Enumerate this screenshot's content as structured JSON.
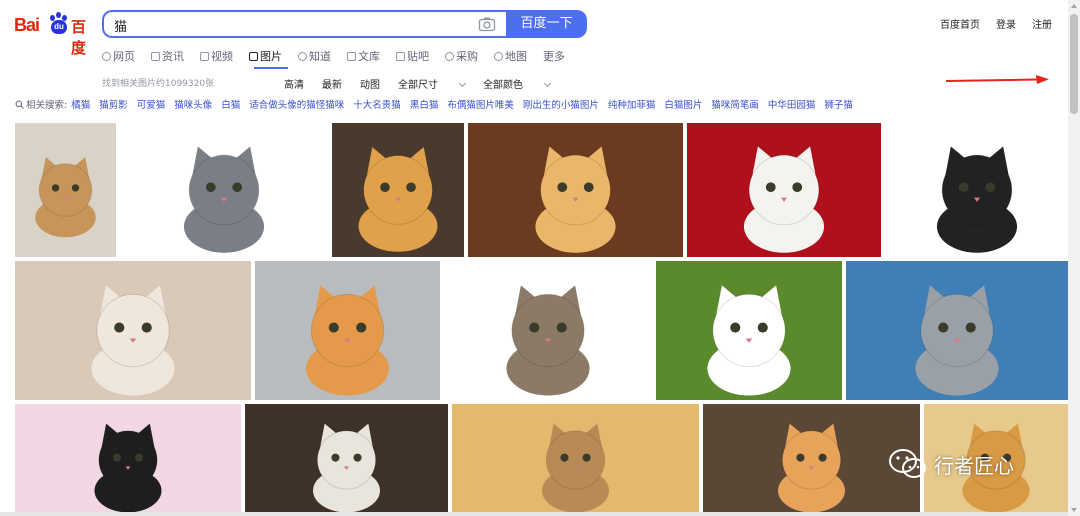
{
  "logo": {
    "bai": "Bai",
    "du": "du",
    "cn": "百度"
  },
  "search": {
    "query": "猫",
    "button_label": "百度一下"
  },
  "top_links": [
    "百度首页",
    "登录",
    "注册"
  ],
  "tabs": [
    {
      "label": "网页",
      "icon": "search-icon"
    },
    {
      "label": "资讯",
      "icon": "news-icon"
    },
    {
      "label": "视频",
      "icon": "video-icon"
    },
    {
      "label": "图片",
      "icon": "image-icon",
      "active": true
    },
    {
      "label": "知道",
      "icon": "question-icon"
    },
    {
      "label": "文库",
      "icon": "document-icon"
    },
    {
      "label": "贴吧",
      "icon": "forum-icon"
    },
    {
      "label": "采购",
      "icon": "cart-icon"
    },
    {
      "label": "地图",
      "icon": "map-icon"
    },
    {
      "label": "更多",
      "icon": ""
    }
  ],
  "result_count": "找到相关图片约1099320张",
  "filters": [
    {
      "label": "高清",
      "dropdown": false
    },
    {
      "label": "最新",
      "dropdown": false
    },
    {
      "label": "动图",
      "dropdown": false
    },
    {
      "label": "全部尺寸",
      "dropdown": true
    },
    {
      "label": "全部颜色",
      "dropdown": true
    }
  ],
  "related": {
    "label": "相关搜索:",
    "keywords": [
      "橘猫",
      "猫剪影",
      "可爱猫",
      "猫咪头像",
      "白猫",
      "适合做头像的猫怪猫咪",
      "十大名贵猫",
      "黑白猫",
      "布偶猫图片唯美",
      "刚出生的小猫图片",
      "纯种加菲猫",
      "白猫图片",
      "猫咪简笔画",
      "中华田园猫",
      "狮子猫"
    ]
  },
  "watermark": {
    "text": "行者匠心",
    "icon": "wechat-icon"
  },
  "colors": {
    "brand_blue": "#4e6ef2",
    "brand_red": "#de2910",
    "link_blue": "#3a4fd0",
    "arrow_red": "#e8231e"
  }
}
